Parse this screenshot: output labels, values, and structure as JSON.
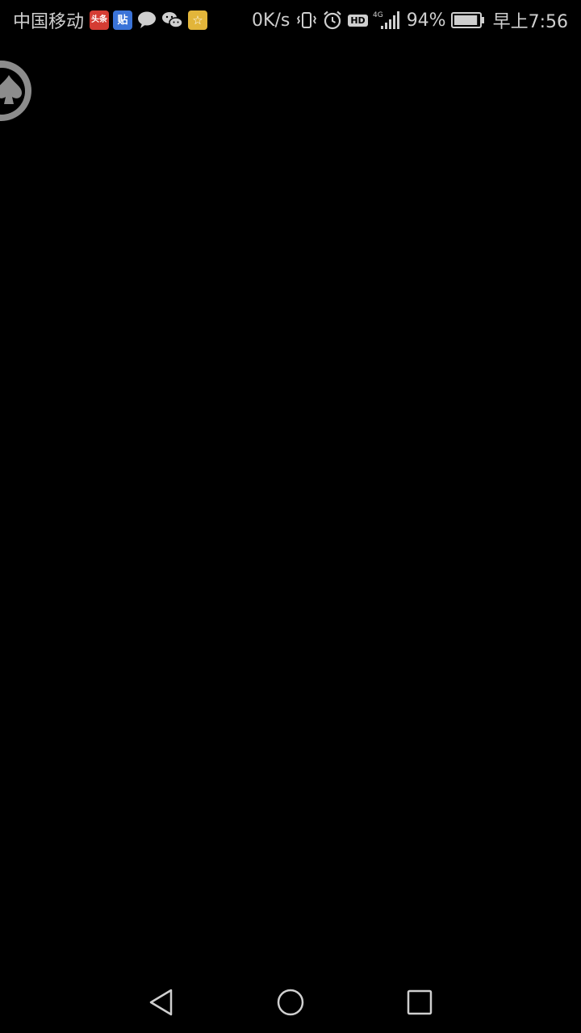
{
  "status_bar": {
    "carrier": "中国移动",
    "notifications": [
      {
        "name": "toutiao-app-icon",
        "label": "头条"
      },
      {
        "name": "tieba-app-icon",
        "label": "贴"
      },
      {
        "name": "message-bubble-icon",
        "label": ""
      },
      {
        "name": "wechat-icon",
        "label": ""
      },
      {
        "name": "star-app-icon",
        "label": "☆"
      }
    ],
    "net_speed": "0K/s",
    "hd_label": "HD",
    "network_type": "4G",
    "battery_percent": "94%",
    "battery_level": 0.94,
    "time": "早上7:56"
  },
  "navigation": {
    "back_icon": "back-triangle-icon",
    "home_icon": "home-circle-icon",
    "recents_icon": "recents-square-icon"
  },
  "colors": {
    "background": "#000000",
    "status_text": "#cfcfcf",
    "nav_icon": "#cfcfcf",
    "float_ball": "#8c8c8c"
  }
}
